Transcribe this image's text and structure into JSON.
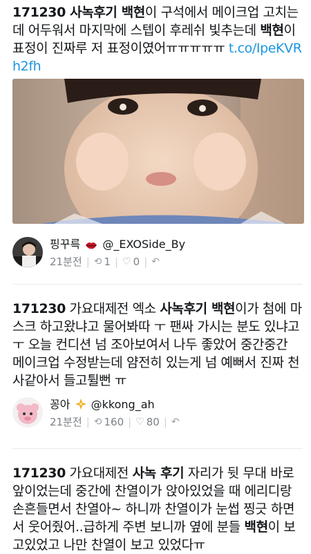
{
  "tweets": [
    {
      "segments": [
        {
          "text": "171230 ",
          "bold": true
        },
        {
          "text": "사녹후기 ",
          "bold": true
        },
        {
          "text": "백현",
          "bold": true
        },
        {
          "text": "이 구석에서 메이크업 고치는데 어두워서 마지막에 스텝이 후레쉬 빛추는데 "
        },
        {
          "text": "백현",
          "bold": true
        },
        {
          "text": "이 표정이 진짜루 저 표정이였어ㅠㅠㅠㅠㅠ "
        },
        {
          "text": "t.co/IpeKVRh2fh",
          "link": true
        }
      ],
      "author": {
        "display_name": "핑꾸륵",
        "handle": "@_EXOSide_By"
      },
      "time": "21분전",
      "retweets": "1",
      "likes": "0"
    },
    {
      "segments": [
        {
          "text": "171230",
          "bold": true
        },
        {
          "text": " 가요대제전 엑소 "
        },
        {
          "text": "사녹후기 백현",
          "bold": true
        },
        {
          "text": "이가 첨에 마스크 하고왔냐고 물어봐따 ㅜ 팬싸 가시는 분도 있냐고 ㅜ 오늘 컨디션 넘 조아보여서 나두 좋았어 중간중간 메이크업 수정받는데 얌전히 있는게 넘 예뻐서 진짜 천사같아서 들고튈뻔 ㅠ"
        }
      ],
      "author": {
        "display_name": "꽁아",
        "handle": "@kkong_ah"
      },
      "time": "21분전",
      "retweets": "160",
      "likes": "80"
    },
    {
      "segments": [
        {
          "text": "171230",
          "bold": true
        },
        {
          "text": " 가요대제전 "
        },
        {
          "text": "사녹 후기",
          "bold": true
        },
        {
          "text": " 자리가 뒷 무대 바로 앞이었는데 중간에 찬열이가 앉아있었을 때 에리디랑 손흔들면서 찬열아~ 하니까 찬열이가 눈썹 찡긋 하면서 웃어줬어..급하게 주변 보니까 옆에 분들 "
        },
        {
          "text": "백현",
          "bold": true
        },
        {
          "text": "이 보고있었고 나만 찬열이 보고 있었다ㅠ"
        }
      ]
    }
  ],
  "colors": {
    "link": "#1b95e0",
    "meta": "#7b8187",
    "divider": "#e6ecf0"
  },
  "icons": {
    "retweet": "retweet-icon",
    "like": "heart-icon",
    "reply": "reply-icon",
    "lips": "lips-emoji-icon",
    "badge": "badge-emoji-icon"
  }
}
